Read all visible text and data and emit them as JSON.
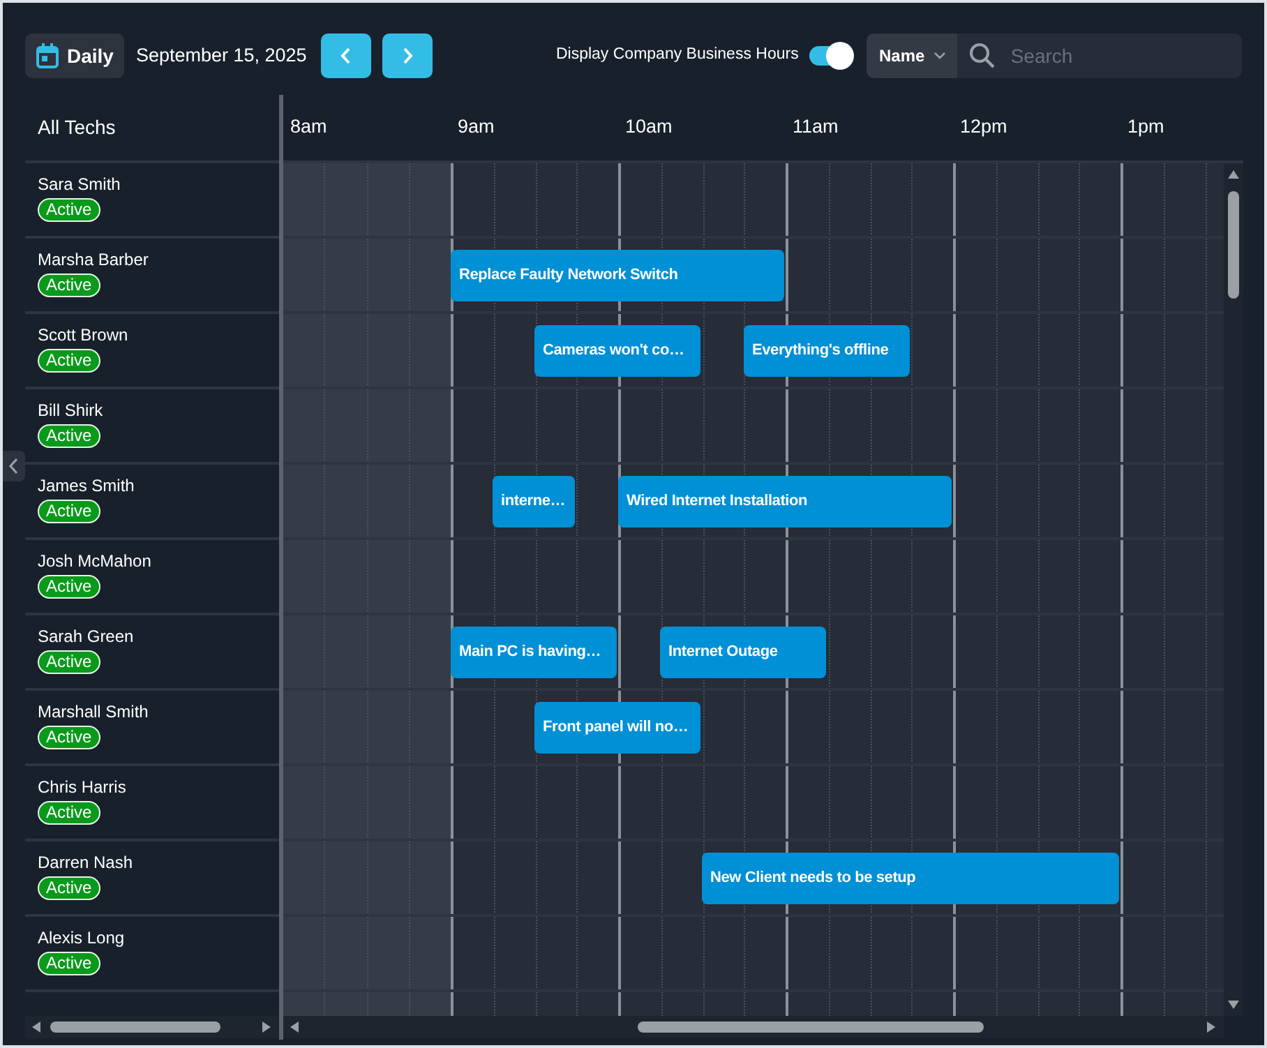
{
  "toolbar": {
    "view_button": "Daily",
    "date": "September 15, 2025",
    "business_hours": {
      "label": "Display Company Business Hours",
      "on": true
    },
    "search": {
      "field": "Name",
      "placeholder": "Search"
    }
  },
  "schedule": {
    "header": "All Techs",
    "hours": [
      {
        "label": "8am",
        "kind": "closed"
      },
      {
        "label": "9am",
        "kind": "open"
      },
      {
        "label": "10am",
        "kind": "open"
      },
      {
        "label": "11am",
        "kind": "open"
      },
      {
        "label": "12pm",
        "kind": "open"
      },
      {
        "label": "1pm",
        "kind": "open"
      }
    ],
    "techs": [
      {
        "name": "Sara Smith",
        "status": "Active"
      },
      {
        "name": "Marsha Barber",
        "status": "Active",
        "events": [
          {
            "title": "Replace Faulty Network Switch"
          }
        ]
      },
      {
        "name": "Scott Brown",
        "status": "Active",
        "events": [
          {
            "title": "Cameras won't co…"
          },
          {
            "title": "Everything's offline"
          }
        ]
      },
      {
        "name": "Bill Shirk",
        "status": "Active"
      },
      {
        "name": "James Smith",
        "status": "Active",
        "events": [
          {
            "title": "interne…"
          },
          {
            "title": "Wired Internet Installation"
          }
        ]
      },
      {
        "name": "Josh McMahon",
        "status": "Active"
      },
      {
        "name": "Sarah Green",
        "status": "Active",
        "events": [
          {
            "title": "Main PC is having…"
          },
          {
            "title": "Internet Outage"
          }
        ]
      },
      {
        "name": "Marshall Smith",
        "status": "Active",
        "events": [
          {
            "title": "Front panel will no…"
          }
        ]
      },
      {
        "name": "Chris Harris",
        "status": "Active"
      },
      {
        "name": "Darren Nash",
        "status": "Active",
        "events": [
          {
            "title": "New Client needs to be setup"
          }
        ]
      },
      {
        "name": "Alexis Long",
        "status": "Active"
      }
    ]
  }
}
